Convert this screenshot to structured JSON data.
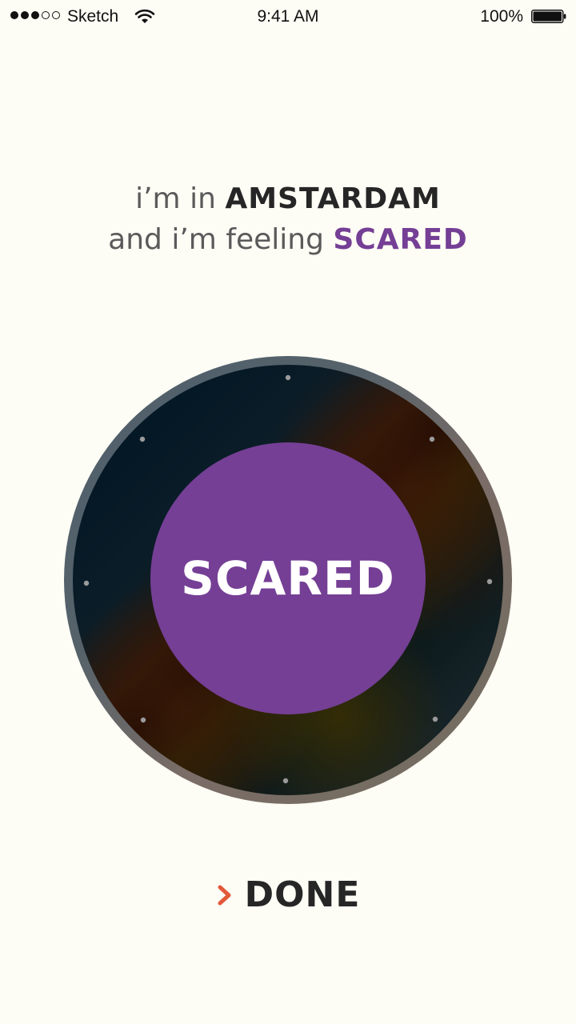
{
  "status_bar": {
    "carrier": "Sketch",
    "time": "9:41 AM",
    "battery": "100%",
    "signal_bars_filled": 3,
    "signal_bars_total": 5
  },
  "headline": {
    "line1_prefix": "i’m in",
    "city": "AMSTARDAM",
    "line2_prefix": "and i’m feeling",
    "mood": "SCARED"
  },
  "dial": {
    "selected_mood": "SCARED",
    "center_color": "#753f95"
  },
  "actions": {
    "done_label": "DONE",
    "done_icon": "chevron-right-icon",
    "accent_color": "#e2593a"
  }
}
